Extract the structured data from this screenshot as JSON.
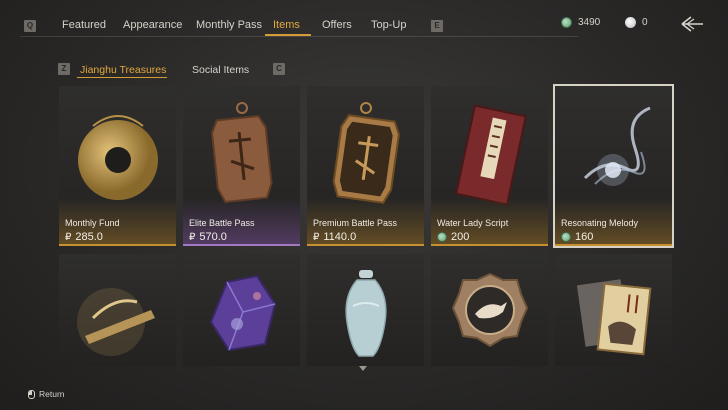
{
  "topbar": {
    "left_key": "Q",
    "right_key": "E",
    "tabs": [
      {
        "label": "Featured"
      },
      {
        "label": "Appearance"
      },
      {
        "label": "Monthly Pass"
      },
      {
        "label": "Items",
        "active": true
      },
      {
        "label": "Offers"
      },
      {
        "label": "Top-Up"
      }
    ],
    "jade_amount": "3490",
    "silver_amount": "0"
  },
  "subtabs": {
    "left_key": "Z",
    "right_key": "C",
    "items": [
      {
        "label": "Jianghu Treasures",
        "active": true
      },
      {
        "label": "Social Items"
      }
    ]
  },
  "items_row1": [
    {
      "name": "Monthly Fund",
      "currency_symbol": "₽",
      "price": "285.0",
      "price_type": "money",
      "rarity": "gold"
    },
    {
      "name": "Elite Battle Pass",
      "currency_symbol": "₽",
      "price": "570.0",
      "price_type": "money",
      "rarity": "purple"
    },
    {
      "name": "Premium Battle Pass",
      "currency_symbol": "₽",
      "price": "1140.0",
      "price_type": "money",
      "rarity": "gold"
    },
    {
      "name": "Water Lady Script",
      "price": "200",
      "price_type": "jade",
      "rarity": "gold"
    },
    {
      "name": "Resonating Melody",
      "price": "160",
      "price_type": "jade",
      "rarity": "gold",
      "selected": true
    }
  ],
  "items_row2_icons": [
    "bamboo-scroll-icon",
    "crystal-ore-icon",
    "porcelain-vase-icon",
    "dove-medal-icon",
    "painting-cards-icon"
  ],
  "footer": {
    "return_label": "Return"
  },
  "colors": {
    "accent": "#e2a93c",
    "gold_border": "#c5902f",
    "purple_border": "#a079c2"
  }
}
